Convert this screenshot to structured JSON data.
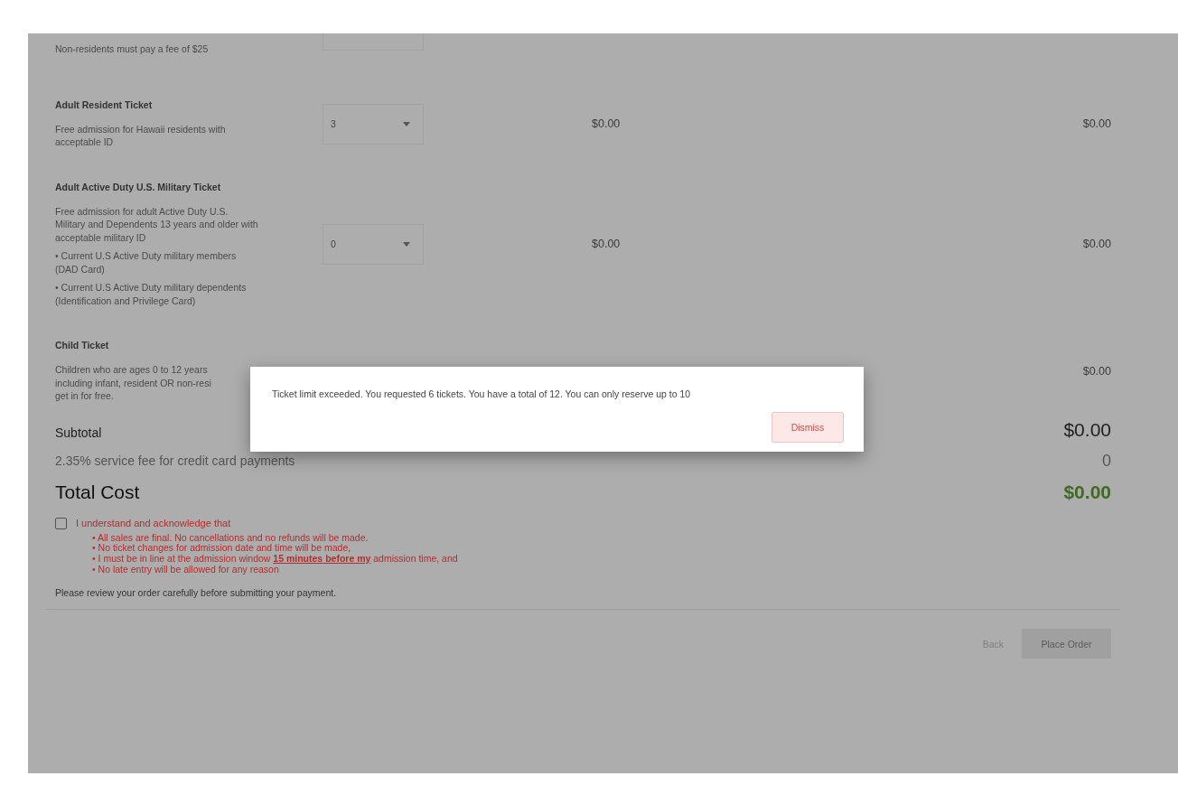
{
  "tickets": [
    {
      "kind": "partial",
      "description": [
        "Non-residents must pay a fee of $25"
      ]
    },
    {
      "kind": "ticket",
      "name": "Adult Resident Ticket",
      "description": [
        "Free admission for Hawaii residents with",
        "acceptable ID"
      ],
      "quantity": "3",
      "price": "$0.00",
      "total": "$0.00"
    },
    {
      "kind": "ticket",
      "name": "Adult Active Duty U.S. Military Ticket",
      "description": [
        "Free admission for adult Active Duty U.S.",
        "Military and Dependents 13 years and older with",
        "acceptable military ID"
      ],
      "bullets": [
        [
          "• Current U.S Active Duty military members",
          "(DAD Card)"
        ],
        [
          "• Current U.S Active Duty military dependents",
          "(Identification and Privilege Card)"
        ]
      ],
      "quantity": "0",
      "price": "$0.00",
      "total": "$0.00"
    },
    {
      "kind": "covered",
      "name": "Child Ticket",
      "description": [
        "Children who are ages 0 to 12 years",
        "including infant, resident OR non-resi",
        "get in for free."
      ],
      "total": "$0.00"
    }
  ],
  "subtotal": {
    "label": "Subtotal",
    "value": "$0.00"
  },
  "service_fee": {
    "label": "2.35% service fee for credit card payments",
    "value": "0"
  },
  "total_cost": {
    "label": "Total Cost",
    "value": "$0.00"
  },
  "acknowledgement": {
    "checked": false,
    "label": "I understand and acknowledge that",
    "items": [
      "• All sales are final. No cancellations and no refunds will be made.",
      "• No ticket changes for admission date and time will be made,",
      "• I must be in line at the admission window **15 minutes before my** admission time, and",
      "• No late entry will be allowed for any reason"
    ]
  },
  "note": "Please review your order carefully before submitting your payment.",
  "buttons": {
    "back": {
      "label": "Back"
    },
    "place_order": {
      "label": "Place Order",
      "disabled": true
    }
  },
  "dialog": {
    "message": "Ticket limit exceeded. You requested 6 tickets. You have a total of 12. You can only reserve up to 10",
    "button": "Dismiss"
  }
}
